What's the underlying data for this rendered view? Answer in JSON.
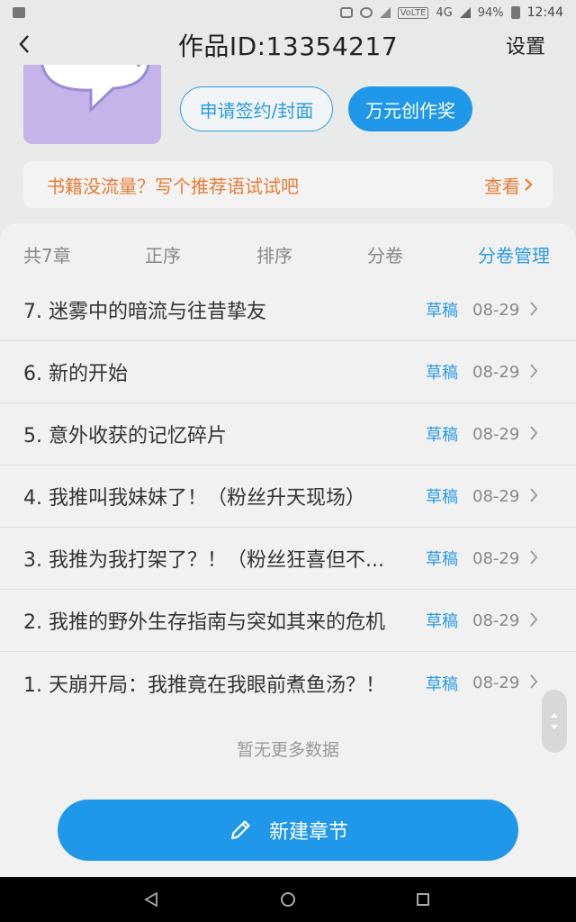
{
  "status_bar": {
    "battery": "94%",
    "time": "12:44",
    "network": "4G",
    "volte": "VoLTE"
  },
  "header": {
    "back_icon": "chevron-left-icon",
    "title": "作品ID:13354217",
    "settings_label": "设置"
  },
  "work": {
    "sign_button": "申请签约/封面",
    "award_button": "万元创作奖"
  },
  "promo": {
    "text": "书籍没流量？写个推荐语试试吧",
    "view_label": "查看"
  },
  "tabs": {
    "count": "共7章",
    "order": "正序",
    "sort": "排序",
    "volume": "分卷",
    "volume_manage": "分卷管理"
  },
  "chapters": [
    {
      "title": "7. 迷雾中的暗流与往昔挚友",
      "status": "草稿",
      "date": "08-29"
    },
    {
      "title": "6. 新的开始",
      "status": "草稿",
      "date": "08-29"
    },
    {
      "title": "5. 意外收获的记忆碎片",
      "status": "草稿",
      "date": "08-29"
    },
    {
      "title": "4. 我推叫我妹妹了！（粉丝升天现场）",
      "status": "草稿",
      "date": "08-29"
    },
    {
      "title": "3. 我推为我打架了？！（粉丝狂喜但不...",
      "status": "草稿",
      "date": "08-29"
    },
    {
      "title": "2. 我推的野外生存指南与突如其来的危机",
      "status": "草稿",
      "date": "08-29"
    },
    {
      "title": "1. 天崩开局：我推竟在我眼前煮鱼汤？！",
      "status": "草稿",
      "date": "08-29"
    }
  ],
  "list_footer": "暂无更多数据",
  "new_chapter_button": "新建章节",
  "colors": {
    "accent": "#1f98ea",
    "promo_text": "#ea7a33",
    "cover": "#c5b3ea"
  }
}
